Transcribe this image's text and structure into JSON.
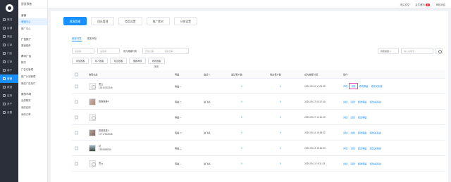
{
  "app": {
    "title": "智慧零售"
  },
  "topbar": {
    "left_link": "来买说空",
    "member": "会员通知",
    "member_badge": "新",
    "account": "审核消息"
  },
  "sidebar": {
    "items": [
      {
        "label": "概况",
        "icon": "home-icon"
      },
      {
        "label": "店铺",
        "icon": "store-icon"
      },
      {
        "label": "商品",
        "icon": "goods-icon"
      },
      {
        "label": "订单",
        "icon": "order-icon"
      },
      {
        "label": "门店",
        "icon": "shop-icon"
      },
      {
        "label": "订单",
        "icon": "list-icon"
      },
      {
        "label": "客户",
        "icon": "user-icon"
      },
      {
        "label": "营销",
        "icon": "marketing-icon",
        "active": true
      },
      {
        "label": "数据",
        "icon": "data-icon"
      },
      {
        "label": "应用",
        "icon": "app-icon"
      },
      {
        "label": "资产",
        "icon": "asset-icon"
      },
      {
        "label": "设置",
        "icon": "gear-icon"
      }
    ]
  },
  "subnav": {
    "groups": [
      {
        "title": "营销",
        "items": [
          {
            "label": "营销中心",
            "active": true
          },
          {
            "label": "推广中心"
          }
        ]
      },
      {
        "title": "广告推广",
        "items": [
          {
            "label": "渠道推荐"
          }
        ]
      },
      {
        "title": "腾讯广告",
        "items": [
          {
            "label": "概况"
          },
          {
            "label": "广告位管理"
          },
          {
            "label": "推广计划管理"
          },
          {
            "label": "微信广告接口"
          }
        ]
      },
      {
        "title": "服务市场",
        "items": [
          {
            "label": "全部服务"
          },
          {
            "label": "我的应用"
          },
          {
            "label": "我的订单"
          }
        ]
      }
    ]
  },
  "tabs": [
    "推客管理",
    "团队管理",
    "商品设置",
    "推广素材",
    "分销设置"
  ],
  "subtabs": [
    "推客列表",
    "推客审核"
  ],
  "filters": {
    "select1": "请选择",
    "select2": "请选择",
    "time_label": "成为推客时间",
    "date_start": "开始日期",
    "date_sep": "~",
    "date_end": "结束日期",
    "type_select": "搜索类型",
    "search_placeholder": "输入关键字"
  },
  "buttons": [
    "添加推客",
    "导入推客",
    "导出推客",
    "推客审核",
    "修改推客关系"
  ],
  "table": {
    "headers": [
      "推客信息",
      "等级",
      "邀请人",
      "邀请客户数",
      "绑定客户数",
      "成为推客时间",
      "操作"
    ],
    "rows": [
      {
        "name": "黑云",
        "phone": "13910332346",
        "avatar": "default",
        "level": "等级一",
        "inviter": "",
        "invited": "0",
        "bound": "0",
        "time": "2020-09-01 17:03:59",
        "ops": [
          "详情",
          "清除",
          "修改等级",
          "修改关系链"
        ]
      },
      {
        "name": "数推推推4",
        "phone": "",
        "avatar": "photo1",
        "level": "等级二",
        "inviter": "谁飞机",
        "invited": "0",
        "bound": "0",
        "time": "2020-09-27 03:27:48",
        "ops": [
          "详情",
          "清除",
          "修改等级",
          "修改关系链"
        ]
      },
      {
        "name": "",
        "phone": "",
        "avatar": "default",
        "level": "等级一",
        "inviter": "",
        "invited": "0",
        "bound": "0",
        "time": "2020-09-17 10:10:39",
        "ops": [
          "详情",
          "清除",
          "修改等级"
        ]
      },
      {
        "name": "数推推推4",
        "phone": "17717622648",
        "avatar": "photo2",
        "level": "等级二",
        "inviter": "谁飞机",
        "invited": "0",
        "bound": "0",
        "time": "2020-09-14 16:18:02",
        "ops": [
          "详情",
          "清除",
          "修改等级",
          "修改关系链"
        ]
      },
      {
        "name": "玩",
        "phone": "1939455536",
        "avatar": "photo3",
        "level": "等级二",
        "inviter": "",
        "invited": "0",
        "bound": "0",
        "time": "2020-09-13 18:16:53",
        "ops": [
          "详情",
          "清除",
          "修改等级",
          "修改关系链"
        ]
      },
      {
        "name": "黑云",
        "phone": "",
        "avatar": "default",
        "level": "等级一",
        "inviter": "谁飞机",
        "invited": "0",
        "bound": "0",
        "time": "2020-09-11 19:11:33",
        "ops": [
          "详情",
          "清除",
          "修改等级",
          "修改关系链"
        ]
      }
    ]
  }
}
